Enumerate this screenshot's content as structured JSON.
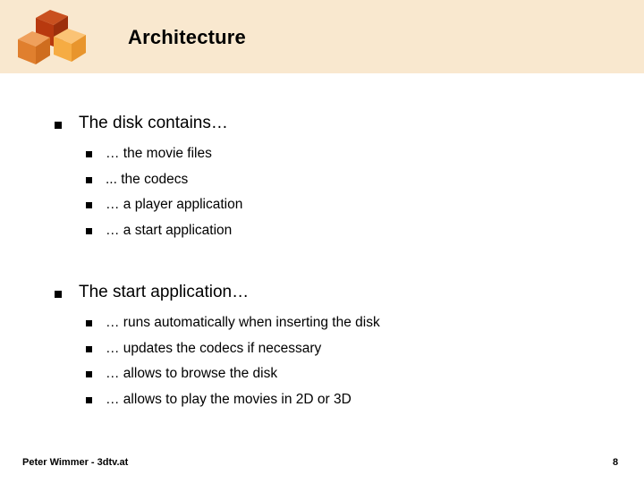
{
  "slide": {
    "title": "Architecture",
    "page_number": "8",
    "theme": {
      "header_band_color": "#f9e8cf",
      "body_background": "#ffffff",
      "text_color": "#000000",
      "cube_top_color": "#b33a10",
      "cube_left_color": "#e07b2a",
      "cube_right_color": "#f5a93f"
    }
  },
  "logo": {
    "name": "three-cubes-logo",
    "cubes": [
      {
        "name": "dark-red-cube",
        "color": "#b8390f"
      },
      {
        "name": "orange-cube",
        "color": "#e07f2e"
      },
      {
        "name": "light-orange-cube",
        "color": "#f6ac43"
      }
    ]
  },
  "content": {
    "groups": [
      {
        "id": "disk",
        "heading": "The disk contains…",
        "items": [
          "… the movie files",
          "... the codecs",
          "… a player application",
          "… a start application"
        ]
      },
      {
        "id": "start",
        "heading": "The start application…",
        "items": [
          "… runs automatically when inserting the disk",
          "… updates the codecs if necessary",
          "… allows to browse the disk",
          "… allows to play the movies in 2D or 3D"
        ]
      }
    ]
  },
  "footer": {
    "author": "Peter Wimmer - 3dtv.at",
    "page_number": "8"
  }
}
